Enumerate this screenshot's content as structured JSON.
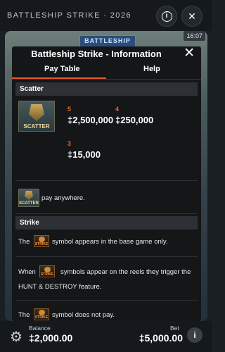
{
  "app": {
    "title": "BATTLESHIP STRIKE · 2026"
  },
  "game": {
    "logo": "BATTLESHIP",
    "clock": "16:07"
  },
  "modal": {
    "title": "Battleship Strike - Information",
    "tabs": [
      {
        "label": "Pay Table"
      },
      {
        "label": "Help"
      }
    ],
    "scatter": {
      "heading": "Scatter",
      "symbol_label": "SCATTER",
      "payouts": [
        {
          "count": "5",
          "value": "‡2,500,000"
        },
        {
          "count": "4",
          "value": "‡250,000"
        },
        {
          "count": "3",
          "value": "‡15,000"
        }
      ],
      "anywhere_text": "pay anywhere."
    },
    "strike": {
      "heading": "Strike",
      "symbol_label": "STRIKE",
      "line1_pre": "The",
      "line1_post": "symbol appears in the base game only.",
      "line2_pre": "When",
      "line2_post": "symbols appear on the reels they trigger the",
      "line2_cont": "HUNT & DESTROY feature.",
      "line3_pre": "The",
      "line3_post": "symbol does not pay."
    }
  },
  "footer": {
    "balance_label": "Balance",
    "balance_value": "‡2,000.00",
    "bet_label": "Bet",
    "bet_value": "‡5,000.00"
  }
}
